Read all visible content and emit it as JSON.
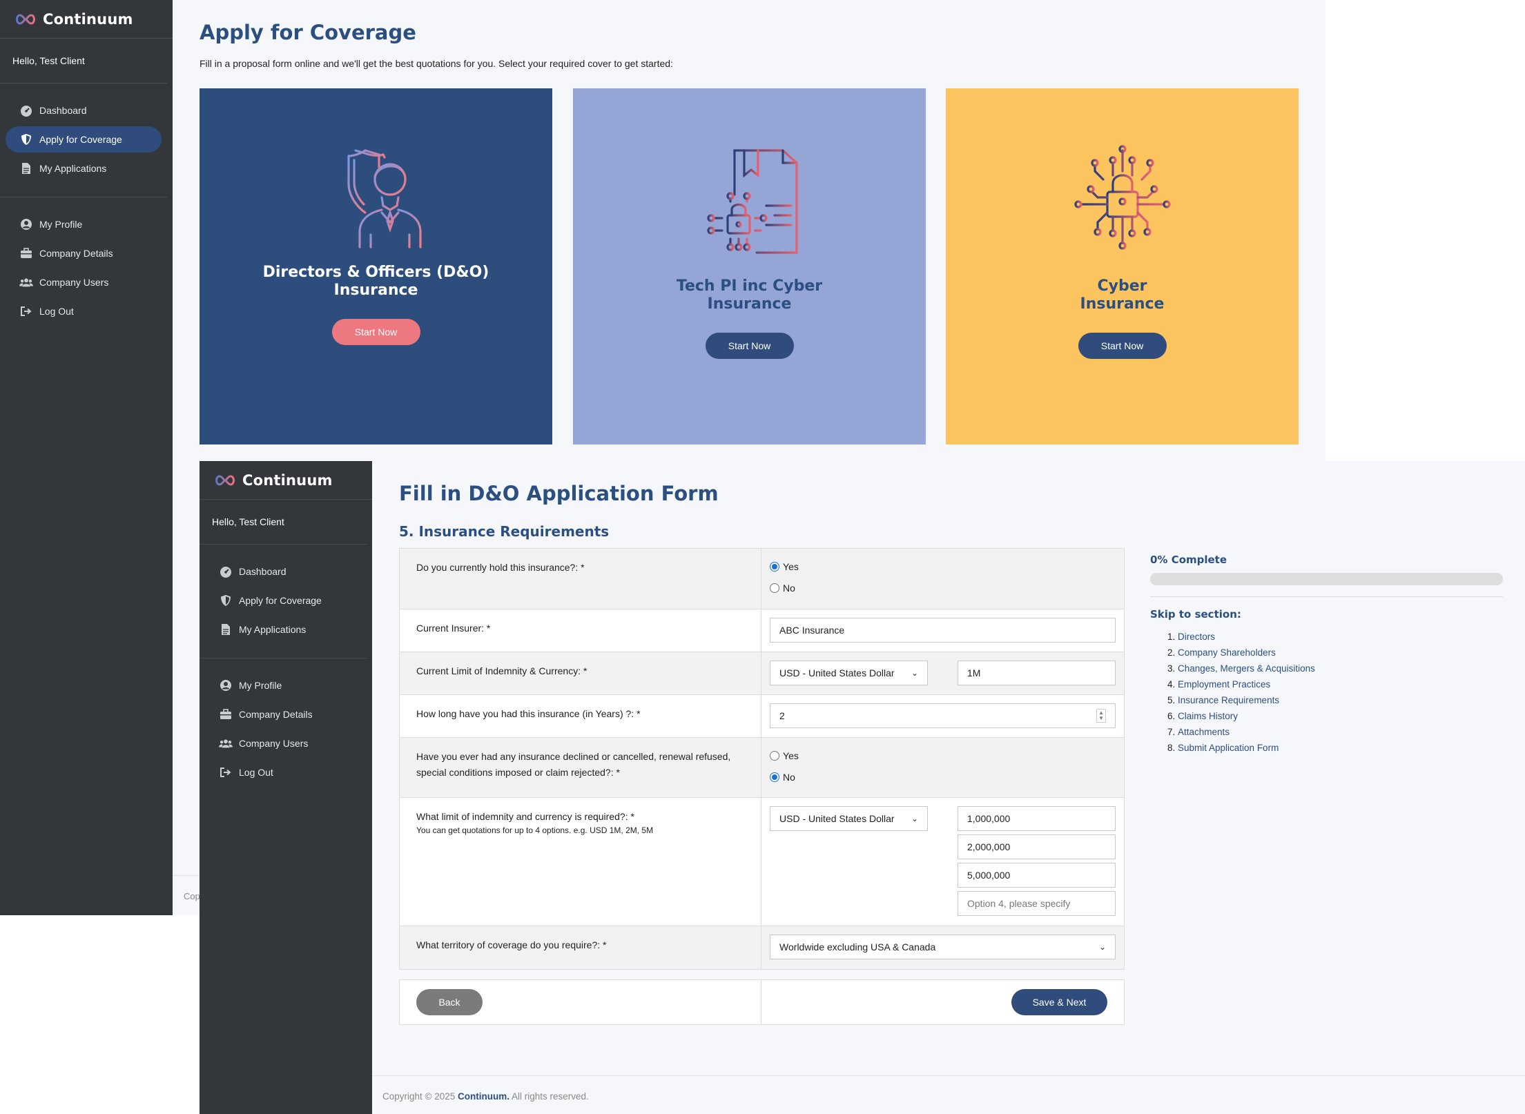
{
  "brand": "Continuum",
  "greeting": "Hello, Test Client",
  "nav": {
    "dashboard": "Dashboard",
    "apply": "Apply for Coverage",
    "applications": "My Applications",
    "profile": "My Profile",
    "company": "Company Details",
    "users": "Company Users",
    "logout": "Log Out"
  },
  "screen1": {
    "title": "Apply for Coverage",
    "intro": "Fill in a proposal form online and we'll get the best quotations for you. Select your required cover to get started:",
    "cards": [
      {
        "title": "Directors & Officers (D&O) Insurance",
        "button": "Start Now",
        "color": "#2d4d7c"
      },
      {
        "title": "Tech PI inc Cyber Insurance",
        "button": "Start Now",
        "color": "#94a5d6"
      },
      {
        "title": "Cyber Insurance",
        "button": "Start Now",
        "color": "#fbc45f"
      }
    ],
    "footer_fragment": "Cop"
  },
  "screen2": {
    "title": "Fill in D&O Application Form",
    "section": "5. Insurance Requirements",
    "q1": {
      "label": "Do you currently hold this insurance?: *",
      "opt_yes": "Yes",
      "opt_no": "No",
      "selected": "Yes"
    },
    "q2": {
      "label": "Current Insurer: *",
      "value": "ABC Insurance"
    },
    "q3": {
      "label": "Current Limit of Indemnity & Currency: *",
      "currency": "USD - United States Dollar",
      "value": "1M"
    },
    "q4": {
      "label": "How long have you had this insurance (in Years) ?: *",
      "value": "2"
    },
    "q5": {
      "label": "Have you ever had any insurance declined or cancelled, renewal refused, special conditions imposed or claim rejected?: *",
      "opt_yes": "Yes",
      "opt_no": "No",
      "selected": "No"
    },
    "q6": {
      "label": "What limit of indemnity and currency is required?: *",
      "hint": "You can get quotations for up to 4 options. e.g. USD 1M, 2M, 5M",
      "currency": "USD - United States Dollar",
      "option1": "1,000,000",
      "option2": "2,000,000",
      "option3": "5,000,000",
      "option4_placeholder": "Option 4, please specify"
    },
    "q7": {
      "label": "What territory of coverage do you require?: *",
      "value": "Worldwide excluding USA & Canada"
    },
    "back": "Back",
    "next": "Save & Next",
    "progress": {
      "label": "0% Complete",
      "value": 0
    },
    "skip_title": "Skip to section:",
    "sections": [
      "Directors",
      "Company Shareholders",
      "Changes, Mergers & Acquisitions",
      "Employment Practices",
      "Insurance Requirements",
      "Claims History",
      "Attachments",
      "Submit Application Form"
    ],
    "footer": {
      "prefix": "Copyright © 2025 ",
      "brand": "Continuum.",
      "suffix": " All rights reserved."
    }
  },
  "icons": {
    "dashboard": "dashboard-gauge-icon",
    "apply": "shield-icon",
    "applications": "document-icon",
    "profile": "user-circle-icon",
    "company": "briefcase-icon",
    "users": "users-icon",
    "logout": "logout-icon"
  }
}
